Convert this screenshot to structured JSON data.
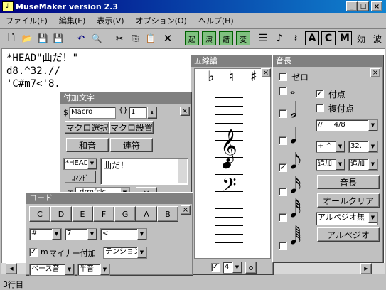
{
  "window": {
    "title": "MuseMaker  version 2.3"
  },
  "menu": [
    "ファイル(F)",
    "編集(E)",
    "表示(V)",
    "オプション(O)",
    "ヘルプ(H)"
  ],
  "editor": {
    "lines": [
      "*HEAD\"曲だ！\"",
      "d8.^32.//",
      "'C#m7<'8."
    ]
  },
  "status": {
    "line": "3行目"
  },
  "staff_panel": {
    "title": "五線譜",
    "accidentals": [
      "♭",
      "♮",
      "♯"
    ],
    "treble": "𝄞",
    "bass": "𝄢",
    "bottom_value": "4",
    "bottom_button": "o"
  },
  "length_panel": {
    "title": "音長",
    "zero_label": "ゼロ",
    "dotted_label": "付点",
    "double_dotted_label": "複付点",
    "fraction": "//",
    "fraction_value": "4/8",
    "tie_sel": "+ ^",
    "num_sel": "32.",
    "add_sel1": "追加",
    "add_sel2": "追加",
    "length_button": "音長",
    "all_clear_button": "オールクリア",
    "arpeggio_sel": "アルペジオ無",
    "arpeggio_button": "アルペジオ",
    "notes": [
      "𝅝",
      "𝅗𝅥",
      "𝅘𝅥",
      "𝅘𝅥𝅮",
      "𝅘𝅥𝅯",
      "𝅘𝅥𝅰",
      "𝅘𝅥𝅱"
    ]
  },
  "addtext_panel": {
    "title": "付加文字",
    "dollar": "$",
    "macro_value": "Macro",
    "brace": "{}",
    "count_value": "1",
    "macro_select_button": "マクロ選択",
    "macro_settings_button": "マクロ設置",
    "chord_button": "和音",
    "tie_button": "連符",
    "head_sel": "*HEAD",
    "command_button": "ｺﾏﾝﾄﾞ",
    "text_value": "曲だ！",
    "lang_label": "伊",
    "lang_value": "drmfslc",
    "x_button": "×"
  },
  "chord_panel": {
    "title": "コード",
    "notes": [
      "C",
      "D",
      "E",
      "F",
      "G",
      "A",
      "B"
    ],
    "sharp_sel": "#",
    "num_sel": "7",
    "angle_sel": "<",
    "minor_label": "m",
    "minor_add_label": "マイナー付加",
    "tension_sel": "テンション",
    "bass_sel": "ベース音",
    "semitone_sel": "半音"
  }
}
